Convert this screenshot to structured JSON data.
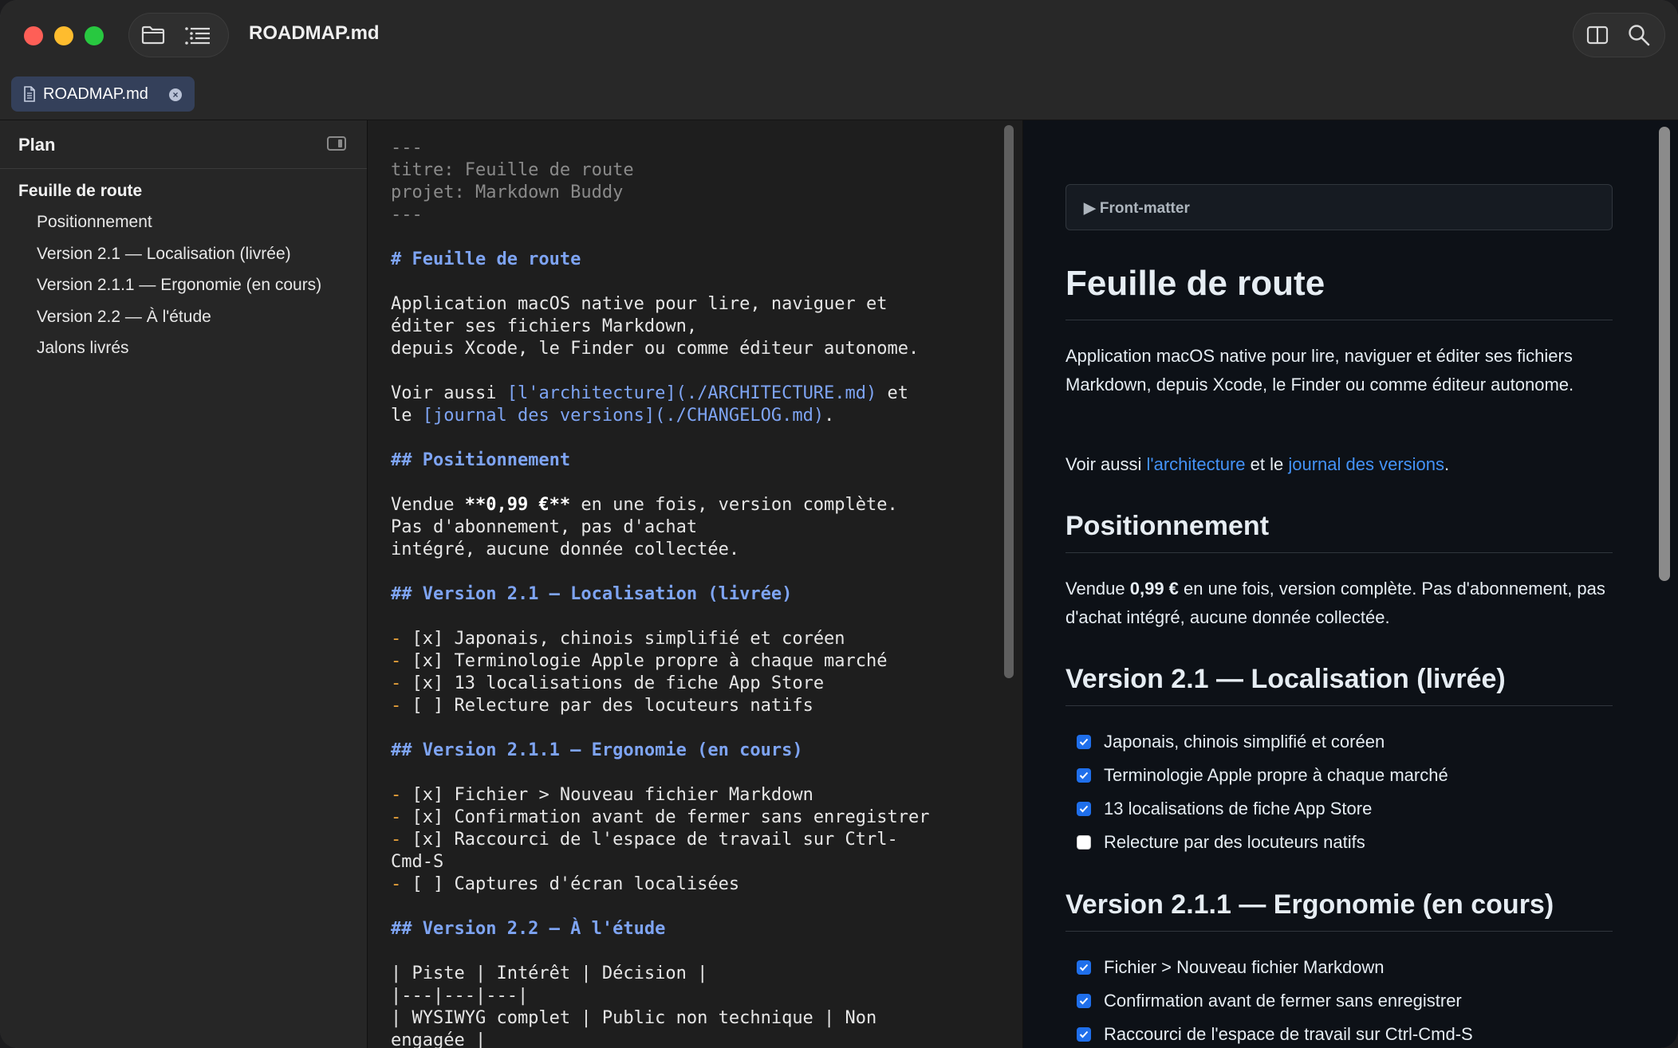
{
  "window": {
    "title": "ROADMAP.md",
    "tab": {
      "label": "ROADMAP.md"
    }
  },
  "sidebar": {
    "title": "Plan",
    "items": [
      {
        "label": "Feuille de route",
        "level": 1
      },
      {
        "label": "Positionnement",
        "level": 2
      },
      {
        "label": "Version 2.1 — Localisation (livrée)",
        "level": 2
      },
      {
        "label": "Version 2.1.1 — Ergonomie (en cours)",
        "level": 2
      },
      {
        "label": "Version 2.2 — À l'étude",
        "level": 2
      },
      {
        "label": "Jalons livrés",
        "level": 2
      }
    ]
  },
  "editor": {
    "fm_open": "---",
    "fm_title": "titre: Feuille de route",
    "fm_project": "projet: Markdown Buddy",
    "fm_close": "---",
    "h1": "# Feuille de route",
    "intro_1": "Application macOS native pour lire, naviguer et",
    "intro_2": "éditer ses fichiers Markdown,",
    "intro_3": "depuis Xcode, le Finder ou comme éditeur autonome.",
    "see_prefix": "Voir aussi ",
    "see_link1": "[l'architecture](./ARCHITECTURE.md)",
    "see_mid": " et",
    "see2_prefix": "le ",
    "see_link2": "[journal des versions](./CHANGELOG.md)",
    "see2_suffix": ".",
    "h2_pos": "## Positionnement",
    "pos_1a": "Vendue ",
    "pos_1b": "**0,99 €**",
    "pos_1c": " en une fois, version complète.",
    "pos_2": "Pas d'abonnement, pas d'achat",
    "pos_3": "intégré, aucune donnée collectée.",
    "h2_v21": "## Version 2.1 — Localisation (livrée)",
    "v21_items": [
      "[x] Japonais, chinois simplifié et coréen",
      "[x] Terminologie Apple propre à chaque marché",
      "[x] 13 localisations de fiche App Store",
      "[ ] Relecture par des locuteurs natifs"
    ],
    "h2_v211": "## Version 2.1.1 — Ergonomie (en cours)",
    "v211_items": [
      "[x] Fichier > Nouveau fichier Markdown",
      "[x] Confirmation avant de fermer sans enregistrer",
      "[x] Raccourci de l'espace de travail sur Ctrl-",
      "[ ] Captures d'écran localisées"
    ],
    "v211_wrap": "Cmd-S",
    "dash": "- ",
    "h2_v22": "## Version 2.2 — À l'étude",
    "table_1": "| Piste | Intérêt | Décision |",
    "table_2": "|---|---|---|",
    "table_3": "| WYSIWYG complet | Public non technique | Non",
    "table_4": "engagée |"
  },
  "preview": {
    "frontmatter_label": "▶ Front-matter",
    "h1": "Feuille de route",
    "intro": "Application macOS native pour lire, naviguer et éditer ses fichiers Markdown, depuis Xcode, le Finder ou comme éditeur autonome.",
    "see_prefix": "Voir aussi ",
    "see_link1": "l'architecture",
    "see_mid": " et le ",
    "see_link2": "journal des versions",
    "see_suffix": ".",
    "h2_pos": "Positionnement",
    "pos_a": "Vendue ",
    "pos_b": "0,99 €",
    "pos_c": " en une fois, version complète. Pas d'abonnement, pas d'achat intégré, aucune donnée collectée.",
    "h2_v21": "Version 2.1 — Localisation (livrée)",
    "v21_tasks": [
      {
        "label": "Japonais, chinois simplifié et coréen",
        "checked": true
      },
      {
        "label": "Terminologie Apple propre à chaque marché",
        "checked": true
      },
      {
        "label": "13 localisations de fiche App Store",
        "checked": true
      },
      {
        "label": "Relecture par des locuteurs natifs",
        "checked": false
      }
    ],
    "h2_v211": "Version 2.1.1 — Ergonomie (en cours)",
    "v211_tasks": [
      {
        "label": "Fichier > Nouveau fichier Markdown",
        "checked": true
      },
      {
        "label": "Confirmation avant de fermer sans enregistrer",
        "checked": true
      },
      {
        "label": "Raccourci de l'espace de travail sur Ctrl-Cmd-S",
        "checked": true
      }
    ]
  },
  "colors": {
    "accent": "#4493f8",
    "heading_markdown": "#7ea4f3",
    "list_marker": "#e9a23b",
    "checkbox": "#1f6feb"
  }
}
